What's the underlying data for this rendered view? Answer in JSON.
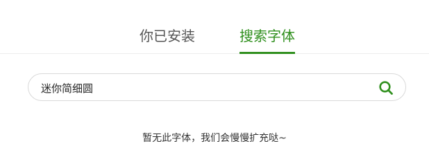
{
  "tabs": {
    "installed_label": "你已安装",
    "search_label": "搜索字体",
    "active": "search"
  },
  "search": {
    "value": "迷你简细圆",
    "icon": "search-icon"
  },
  "empty_message": "暂无此字体，我们会慢慢扩充哒~",
  "colors": {
    "accent": "#2f8f1d",
    "tab_inactive": "#555555",
    "border": "#d9d9d9"
  }
}
